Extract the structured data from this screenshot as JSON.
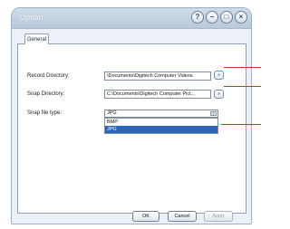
{
  "window": {
    "title": "Option",
    "controls": {
      "help": "?",
      "minimize": "–",
      "maximize": "□",
      "close": "×"
    }
  },
  "tabs": [
    {
      "label": "General"
    }
  ],
  "form": {
    "record_directory": {
      "label": "Record Directory:",
      "value": "\\Documents\\Digitech Computer Videos",
      "browse": "»"
    },
    "snap_directory": {
      "label": "Snap Directory:",
      "value": "C:\\Documents\\Digitech Computer Pict...",
      "browse": "»"
    },
    "snap_file_type": {
      "label": "Snap file type:",
      "selected": "JPG",
      "options": [
        "BMP",
        "JPG"
      ],
      "highlighted_index": 1
    }
  },
  "buttons": {
    "ok": "OK",
    "cancel": "Cancel",
    "apply": "Apply"
  },
  "colors": {
    "callout": "#d03020",
    "selection": "#2c64b8"
  }
}
